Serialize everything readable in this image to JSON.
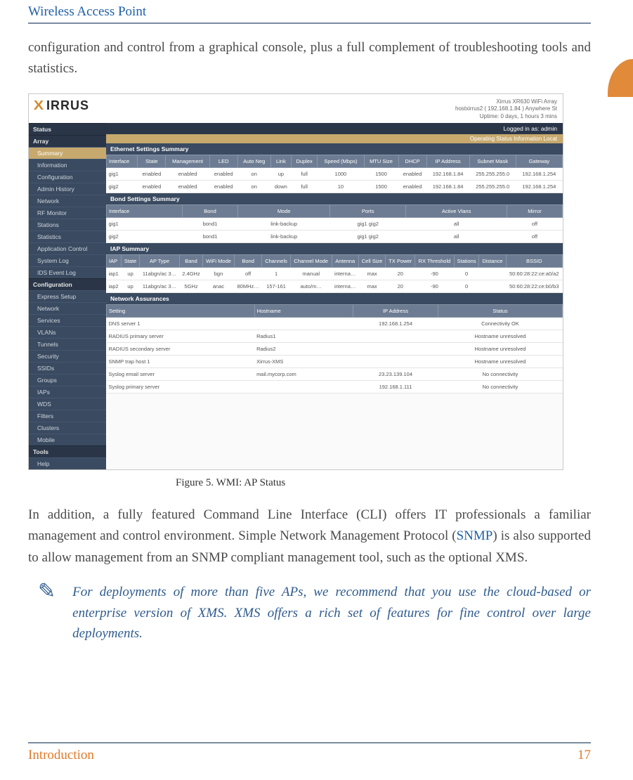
{
  "header": {
    "title": "Wireless Access Point"
  },
  "side_tab": {
    "color": "#e08a3a"
  },
  "intro": "configuration and control from a graphical console, plus a full complement of troubleshooting tools and statistics.",
  "screenshot": {
    "logo_text": "IRRUS",
    "meta": {
      "model": "Xirrus XR630 WiFi Array",
      "hostname": "hostxirrus2 ( 192.168.1.84 ) Anywhere St",
      "uptime": "Uptime: 0 days, 1 hours 3 mins"
    },
    "login_bar": "Logged in as: admin",
    "ops_bar": "Operating Status Information Locat",
    "sidebar": {
      "groups": [
        {
          "title": "Status",
          "items": []
        },
        {
          "title": "Array",
          "items": [
            "Summary",
            "Information",
            "Configuration",
            "Admin History"
          ],
          "selected_index": 0
        },
        {
          "title": "",
          "items": [
            "Network",
            "RF Monitor",
            "Stations",
            "Statistics",
            "Application Control",
            "System Log",
            "IDS Event Log"
          ]
        },
        {
          "title": "Configuration",
          "items": [
            "Express Setup",
            "Network",
            "Services",
            "VLANs",
            "Tunnels",
            "Security",
            "SSIDs",
            "Groups",
            "IAPs",
            "WDS",
            "Filters",
            "Clusters",
            "Mobile"
          ]
        },
        {
          "title": "Tools",
          "items": [
            "Help"
          ]
        }
      ]
    },
    "panels": {
      "eth": {
        "title": "Ethernet Settings Summary",
        "headers": [
          "Interface",
          "State",
          "Management",
          "LED",
          "Auto Neg",
          "Link",
          "Duplex",
          "Speed (Mbps)",
          "MTU Size",
          "DHCP",
          "IP Address",
          "Subnet Mask",
          "Gateway"
        ],
        "rows": [
          [
            "gig1",
            "enabled",
            "enabled",
            "enabled",
            "on",
            "up",
            "full",
            "1000",
            "1500",
            "enabled",
            "192.168.1.84",
            "255.255.255.0",
            "192.168.1.254"
          ],
          [
            "gig2",
            "enabled",
            "enabled",
            "enabled",
            "on",
            "down",
            "full",
            "10",
            "1500",
            "enabled",
            "192.168.1.84",
            "255.255.255.0",
            "192.168.1.254"
          ]
        ]
      },
      "bond": {
        "title": "Bond Settings Summary",
        "headers": [
          "Interface",
          "Bond",
          "Mode",
          "Ports",
          "Active Vlans",
          "Mirror"
        ],
        "rows": [
          [
            "gig1",
            "bond1",
            "link-backup",
            "gig1 gig2",
            "all",
            "off"
          ],
          [
            "gig2",
            "bond1",
            "link-backup",
            "gig1 gig2",
            "all",
            "off"
          ]
        ]
      },
      "iap": {
        "title": "IAP Summary",
        "headers": [
          "IAP",
          "State",
          "AP Type",
          "Band",
          "WiFi Mode",
          "Bond",
          "Channels",
          "Channel Mode",
          "Antenna",
          "Cell Size",
          "TX Power",
          "RX Threshold",
          "Stations",
          "Distance",
          "BSSID"
        ],
        "rows": [
          [
            "iap1",
            "up",
            "11abgn/ac 3…",
            "2.4GHz",
            "bgn",
            "off",
            "1",
            "manual",
            "interna…",
            "max",
            "20",
            "-90",
            "0",
            "",
            "50:60:28:22:ce:a0/a2"
          ],
          [
            "iap2",
            "up",
            "11abgn/ac 3…",
            "5GHz",
            "anac",
            "80MHz…",
            "157-161",
            "auto/m…",
            "interna…",
            "max",
            "20",
            "-90",
            "0",
            "",
            "50:60:28:22:ce:b0/b3"
          ]
        ]
      },
      "assur": {
        "title": "Network Assurances",
        "headers": [
          "Setting",
          "Hostname",
          "IP Address",
          "Status"
        ],
        "rows": [
          [
            "DNS server 1",
            "",
            "192.168.1.254",
            "Connectivity OK"
          ],
          [
            "RADIUS primary server",
            "Radius1",
            "",
            "Hostname unresolved"
          ],
          [
            "RADIUS secondary server",
            "Radius2",
            "",
            "Hostname unresolved"
          ],
          [
            "SNMP trap host 1",
            "Xirrus-XMS",
            "",
            "Hostname unresolved"
          ],
          [
            "Syslog email server",
            "mail.mycorp.com",
            "23.23.139.104",
            "No connectivity"
          ],
          [
            "Syslog primary server",
            "",
            "192.168.1.111",
            "No connectivity"
          ]
        ]
      }
    }
  },
  "figure_caption": "Figure 5. WMI: AP Status",
  "para2_a": "In addition, a fully featured Command Line Interface (CLI) offers IT professionals a familiar management and control environment. Simple Network Management Protocol (",
  "para2_link": "SNMP",
  "para2_b": ") is also supported to allow management from an SNMP compliant management tool, such as the optional XMS.",
  "note": {
    "icon": "✎",
    "text": "For deployments of more than five APs, we recommend that you use the cloud-based or enterprise version of XMS. XMS offers a rich set of features for fine control over large deployments."
  },
  "footer": {
    "section": "Introduction",
    "page": "17"
  }
}
